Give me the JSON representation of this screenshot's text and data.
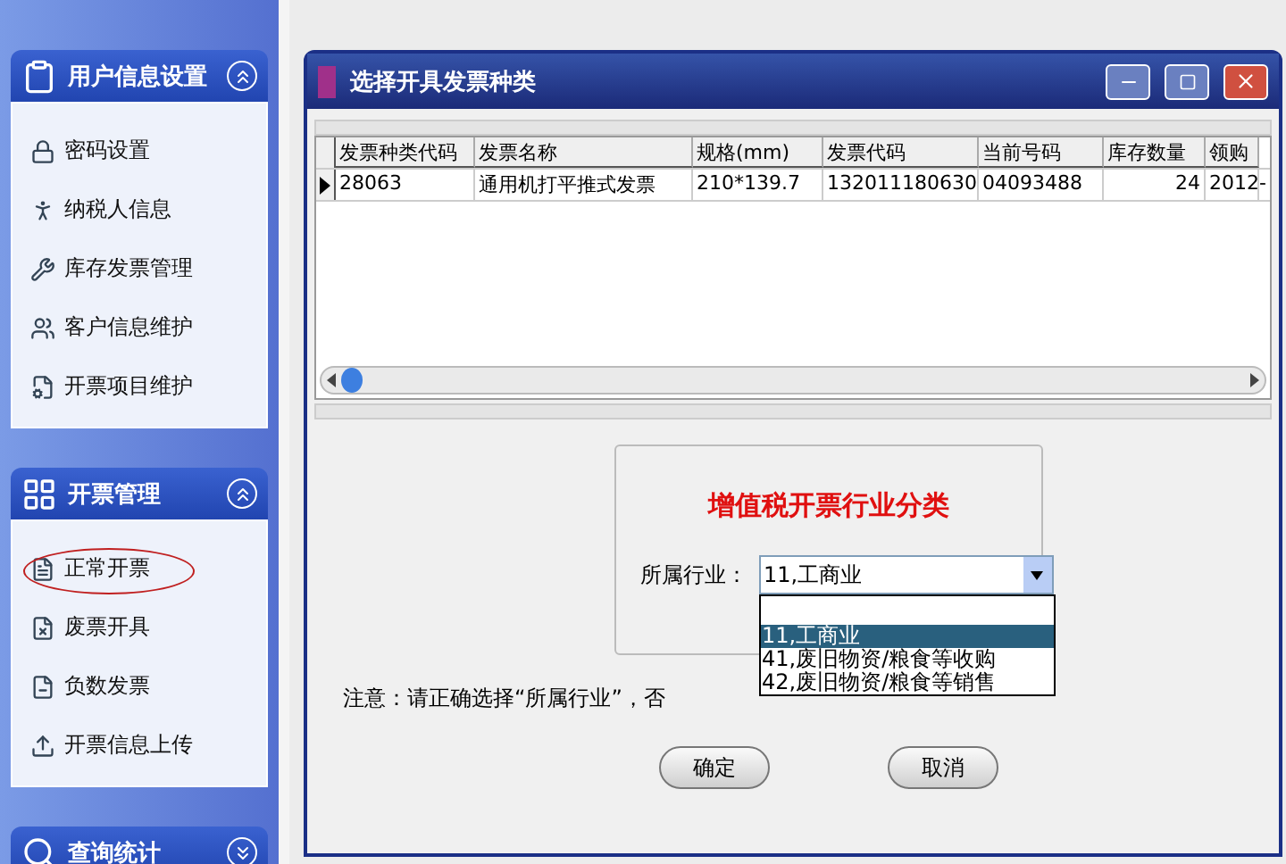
{
  "sidebar": {
    "sections": [
      {
        "title": "用户信息设置",
        "expanded": true,
        "items": [
          {
            "label": "密码设置",
            "circled": false
          },
          {
            "label": "纳税人信息",
            "circled": false
          },
          {
            "label": "库存发票管理",
            "circled": false
          },
          {
            "label": "客户信息维护",
            "circled": false
          },
          {
            "label": "开票项目维护",
            "circled": false
          }
        ]
      },
      {
        "title": "开票管理",
        "expanded": true,
        "items": [
          {
            "label": "正常开票",
            "circled": true
          },
          {
            "label": "废票开具",
            "circled": false
          },
          {
            "label": "负数发票",
            "circled": false
          },
          {
            "label": "开票信息上传",
            "circled": false
          }
        ]
      },
      {
        "title": "查询统计",
        "expanded": false
      }
    ]
  },
  "dialog": {
    "title": "选择开具发票种类",
    "table": {
      "columns": [
        "发票种类代码",
        "发票名称",
        "规格(mm)",
        "发票代码",
        "当前号码",
        "库存数量",
        "领购"
      ],
      "rows": [
        {
          "current": true,
          "cells": [
            "28063",
            "通用机打平推式发票",
            "210*139.7",
            "132011180630",
            "04093488",
            "24",
            "2012-"
          ]
        }
      ]
    },
    "group": {
      "title": "增值税开票行业分类",
      "field_label": "所属行业：",
      "value": "11,工商业",
      "options": [
        {
          "label": "11,工商业",
          "selected": true
        },
        {
          "label": "41,废旧物资/粮食等收购",
          "selected": false
        },
        {
          "label": "42,废旧物资/粮食等销售",
          "selected": false
        }
      ]
    },
    "note": "注意：请正确选择“所属行业”，否",
    "buttons": [
      "确定",
      "取消"
    ]
  }
}
